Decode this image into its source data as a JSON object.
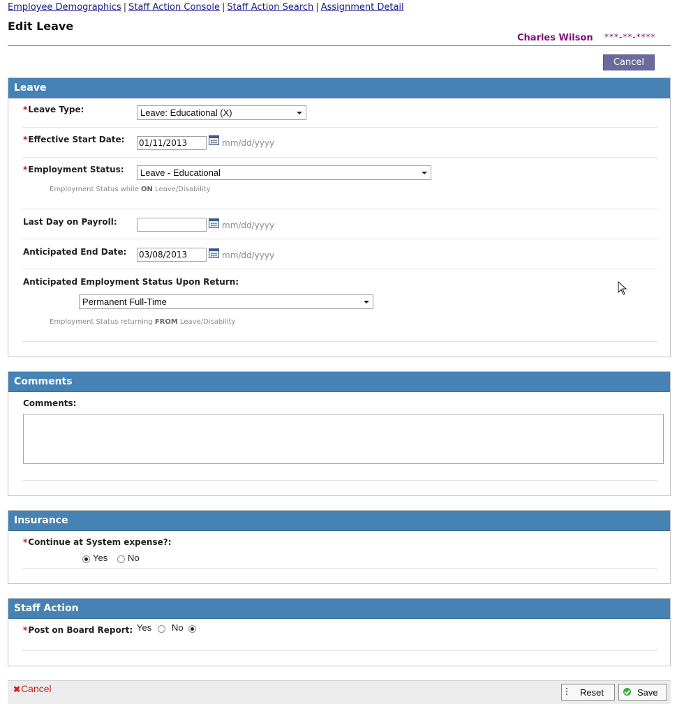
{
  "breadcrumbs": [
    {
      "label": "Employee Demographics"
    },
    {
      "label": "Staff Action Console"
    },
    {
      "label": "Staff Action Search"
    },
    {
      "label": "Assignment Detail"
    }
  ],
  "breadcrumb_separator": "|",
  "page_title": "Edit Leave",
  "employee": {
    "name": "Charles Wilson",
    "ssn_masked": "***-**-****"
  },
  "top_cancel_label": "Cancel",
  "required_marker": "*",
  "leave": {
    "header": "Leave",
    "leave_type": {
      "label": "Leave Type:",
      "value": "Leave: Educational (X)"
    },
    "effective_start": {
      "label": "Effective Start Date:",
      "value": "01/11/2013",
      "format": "mm/dd/yyyy"
    },
    "employment_status": {
      "label": "Employment Status:",
      "value": "Leave - Educational",
      "hint_pre": "Employment Status while ",
      "hint_bold": "ON",
      "hint_post": " Leave/Disability"
    },
    "last_day_payroll": {
      "label": "Last Day on Payroll:",
      "value": "",
      "format": "mm/dd/yyyy"
    },
    "anticipated_end": {
      "label": "Anticipated End Date:",
      "value": "03/08/2013",
      "format": "mm/dd/yyyy"
    },
    "return_status": {
      "label": "Anticipated Employment Status Upon Return:",
      "value": "Permanent Full-Time",
      "hint_pre": "Employment Status returning ",
      "hint_bold": "FROM",
      "hint_post": " Leave/Disability"
    }
  },
  "comments": {
    "header": "Comments",
    "label": "Comments:",
    "value": ""
  },
  "insurance": {
    "header": "Insurance",
    "label": "Continue at System expense?:",
    "yes": "Yes",
    "no": "No",
    "selected": "Yes"
  },
  "staff_action": {
    "header": "Staff Action",
    "label": "Post on Board Report:",
    "yes": "Yes",
    "no": "No",
    "selected": "No"
  },
  "footer": {
    "cancel_label": "Cancel",
    "reset_label": "Reset",
    "save_label": "Save"
  },
  "colors": {
    "panel_header": "#4682b4",
    "employee_name": "#7a0f7a",
    "required": "#cc1111",
    "top_cancel_bg": "#6a6a9c"
  }
}
